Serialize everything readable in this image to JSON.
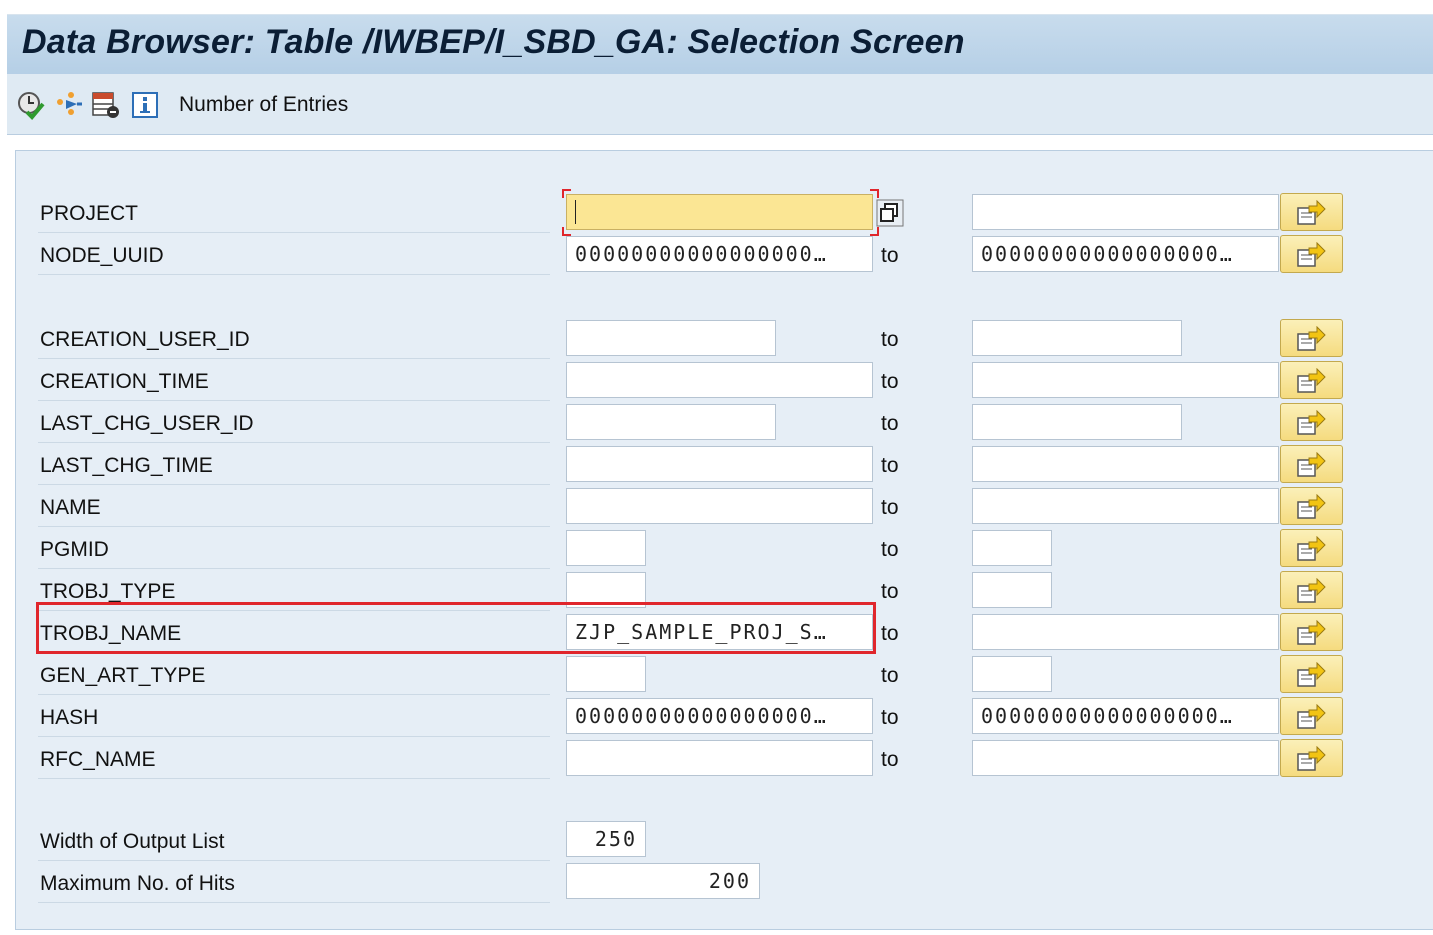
{
  "title": "Data Browser: Table /IWBEP/I_SBD_GA: Selection Screen",
  "toolbar": {
    "icons": [
      "execute-icon",
      "selection-options-icon",
      "delete-entries-icon",
      "info-icon"
    ],
    "number_of_entries": "Number of Entries"
  },
  "colors": {
    "highlight": "#e0262c",
    "active_field": "#fbe694",
    "multi_button": "#f5db7f"
  },
  "to_label": "to",
  "fields": [
    {
      "label": "PROJECT",
      "low": "",
      "high": ""
    },
    {
      "label": "NODE_UUID",
      "low": "00000000000000000…",
      "high": "00000000000000000…"
    },
    {
      "label": "CREATION_USER_ID",
      "low": "",
      "high": ""
    },
    {
      "label": "CREATION_TIME",
      "low": "",
      "high": ""
    },
    {
      "label": "LAST_CHG_USER_ID",
      "low": "",
      "high": ""
    },
    {
      "label": "LAST_CHG_TIME",
      "low": "",
      "high": ""
    },
    {
      "label": "NAME",
      "low": "",
      "high": ""
    },
    {
      "label": "PGMID",
      "low": "",
      "high": ""
    },
    {
      "label": "TROBJ_TYPE",
      "low": "",
      "high": ""
    },
    {
      "label": "TROBJ_NAME",
      "low": "ZJP_SAMPLE_PROJ_S…",
      "high": ""
    },
    {
      "label": "GEN_ART_TYPE",
      "low": "",
      "high": ""
    },
    {
      "label": "HASH",
      "low": "00000000000000000…",
      "high": "00000000000000000…"
    },
    {
      "label": "RFC_NAME",
      "low": "",
      "high": ""
    }
  ],
  "settings": {
    "width_label": "Width of Output List",
    "width_value": "250",
    "max_hits_label": "Maximum No. of Hits",
    "max_hits_value": "200"
  }
}
